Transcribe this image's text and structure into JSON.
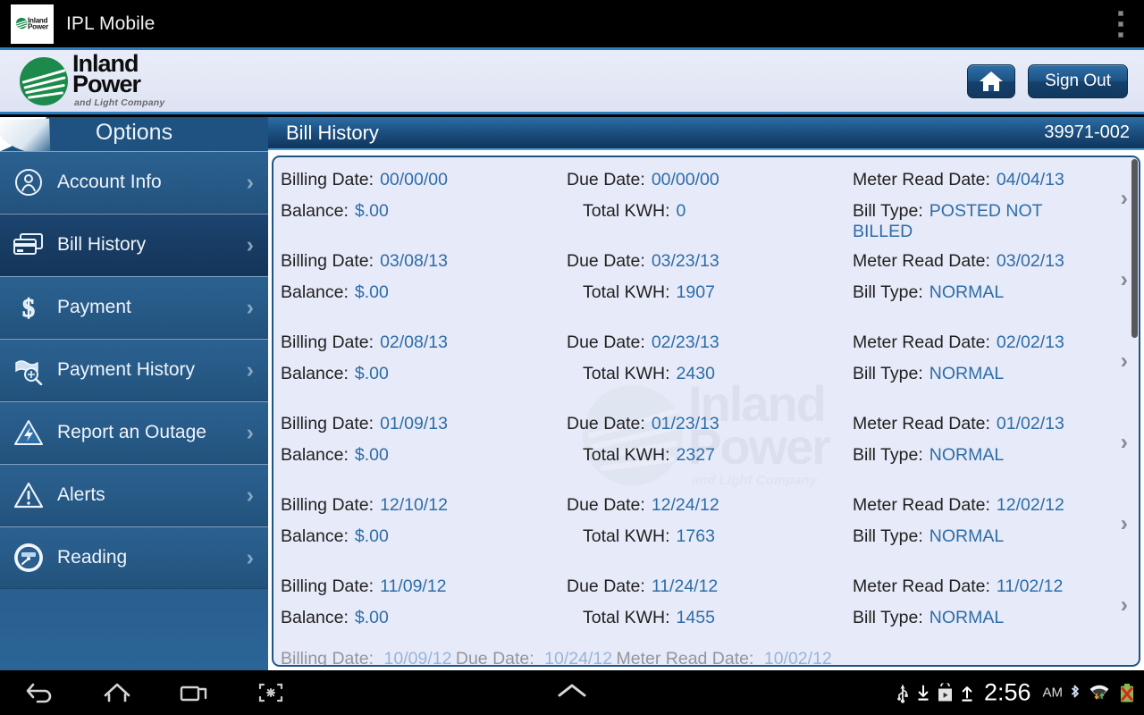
{
  "android": {
    "app_title": "IPL Mobile",
    "overflow_icon": "overflow-menu-icon"
  },
  "brand": {
    "logo_line1": "Inland",
    "logo_line2": "Power",
    "logo_tagline": "and Light Company",
    "home_label": "",
    "signout_label": "Sign Out",
    "accent_blue": "#2a7fc0",
    "brand_green": "#1b8a4b"
  },
  "sidebar": {
    "title": "Options",
    "items": [
      {
        "label": "Account Info",
        "icon": "person-circle-icon",
        "active": false
      },
      {
        "label": "Bill History",
        "icon": "credit-cards-icon",
        "active": true
      },
      {
        "label": "Payment",
        "icon": "dollar-sign-icon",
        "active": false
      },
      {
        "label": "Payment History",
        "icon": "money-search-icon",
        "active": false
      },
      {
        "label": "Report an Outage",
        "icon": "lightning-bolt-triangle-icon",
        "active": false
      },
      {
        "label": "Alerts",
        "icon": "warning-triangle-icon",
        "active": false
      },
      {
        "label": "Reading",
        "icon": "meter-gauge-icon",
        "active": false
      }
    ]
  },
  "content": {
    "title": "Bill History",
    "account_number": "39971-002",
    "labels": {
      "billing_date": "Billing Date:",
      "due_date": "Due Date:",
      "meter_read_date": "Meter Read Date:",
      "balance": "Balance:",
      "total_kwh": "Total KWH:",
      "bill_type": "Bill Type:"
    },
    "rows": [
      {
        "billing_date": "00/00/00",
        "due_date": "00/00/00",
        "meter_read_date": "04/04/13",
        "balance": "$.00",
        "total_kwh": "0",
        "bill_type": "POSTED NOT BILLED"
      },
      {
        "billing_date": "03/08/13",
        "due_date": "03/23/13",
        "meter_read_date": "03/02/13",
        "balance": "$.00",
        "total_kwh": "1907",
        "bill_type": "NORMAL"
      },
      {
        "billing_date": "02/08/13",
        "due_date": "02/23/13",
        "meter_read_date": "02/02/13",
        "balance": "$.00",
        "total_kwh": "2430",
        "bill_type": "NORMAL"
      },
      {
        "billing_date": "01/09/13",
        "due_date": "01/23/13",
        "meter_read_date": "01/02/13",
        "balance": "$.00",
        "total_kwh": "2327",
        "bill_type": "NORMAL"
      },
      {
        "billing_date": "12/10/12",
        "due_date": "12/24/12",
        "meter_read_date": "12/02/12",
        "balance": "$.00",
        "total_kwh": "1763",
        "bill_type": "NORMAL"
      },
      {
        "billing_date": "11/09/12",
        "due_date": "11/24/12",
        "meter_read_date": "11/02/12",
        "balance": "$.00",
        "total_kwh": "1455",
        "bill_type": "NORMAL"
      }
    ],
    "partial_row": {
      "billing_date": "10/09/12",
      "due_date": "10/24/12",
      "meter_read_date": "10/02/12"
    },
    "value_color": "#2d6da8",
    "panel_bg": "#e7eaf8"
  },
  "navbar": {
    "buttons": [
      {
        "name": "back-icon"
      },
      {
        "name": "home-icon"
      },
      {
        "name": "recent-apps-icon"
      },
      {
        "name": "screenshot-icon"
      }
    ],
    "center_icon": "chevron-up-icon"
  },
  "statusbar": {
    "icons_left": [
      "usb-icon",
      "download-arrow-icon",
      "play-store-icon",
      "upload-arrow-icon"
    ],
    "time": "2:56",
    "ampm": "AM",
    "icons_right": [
      "bluetooth-icon",
      "wifi-icon",
      "battery-error-icon"
    ]
  }
}
